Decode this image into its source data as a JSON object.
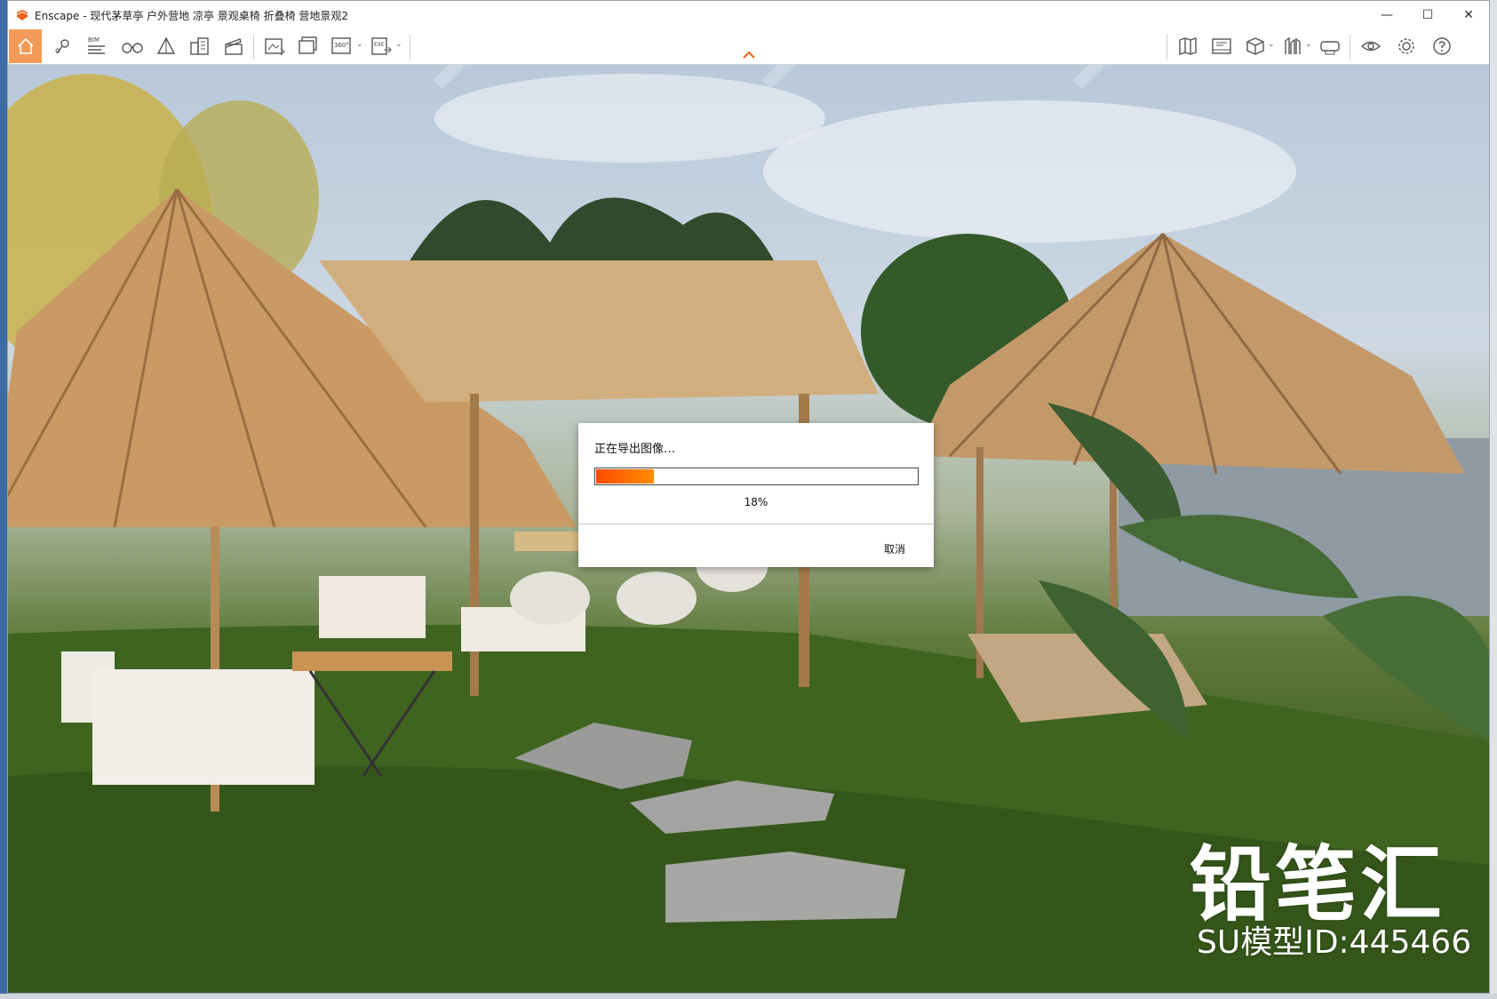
{
  "window": {
    "app_name": "Enscape",
    "title": "Enscape - 现代茅草亭 户外营地 凉亭 景观桌椅 折叠椅 营地景观2",
    "controls": {
      "minimize": "—",
      "maximize": "☐",
      "close": "✕"
    }
  },
  "toolbar": {
    "bim_label": "BIM",
    "pano_label": "360°",
    "exe_label": "EXE",
    "icons": [
      "home-icon",
      "location-pin-icon",
      "bim-icon",
      "binoculars-icon",
      "perspective-icon",
      "buildings-icon",
      "clapper-icon",
      "screenshot-icon",
      "batch-render-icon",
      "panorama-icon",
      "export-exe-icon",
      "map-icon",
      "video-editor-icon",
      "cube-icon",
      "asset-library-icon",
      "vr-headset-icon",
      "visual-settings-icon",
      "settings-icon",
      "help-icon"
    ],
    "accent_color": "#f29a57"
  },
  "dialog": {
    "title": "正在导出图像…",
    "progress": 0.18,
    "progress_text": "18%",
    "cancel_label": "取消",
    "progress_colors": [
      "#ff4a00",
      "#ff8d00"
    ]
  },
  "watermark": {
    "brand": "铅笔汇",
    "model_id": "SU模型ID:445466"
  }
}
